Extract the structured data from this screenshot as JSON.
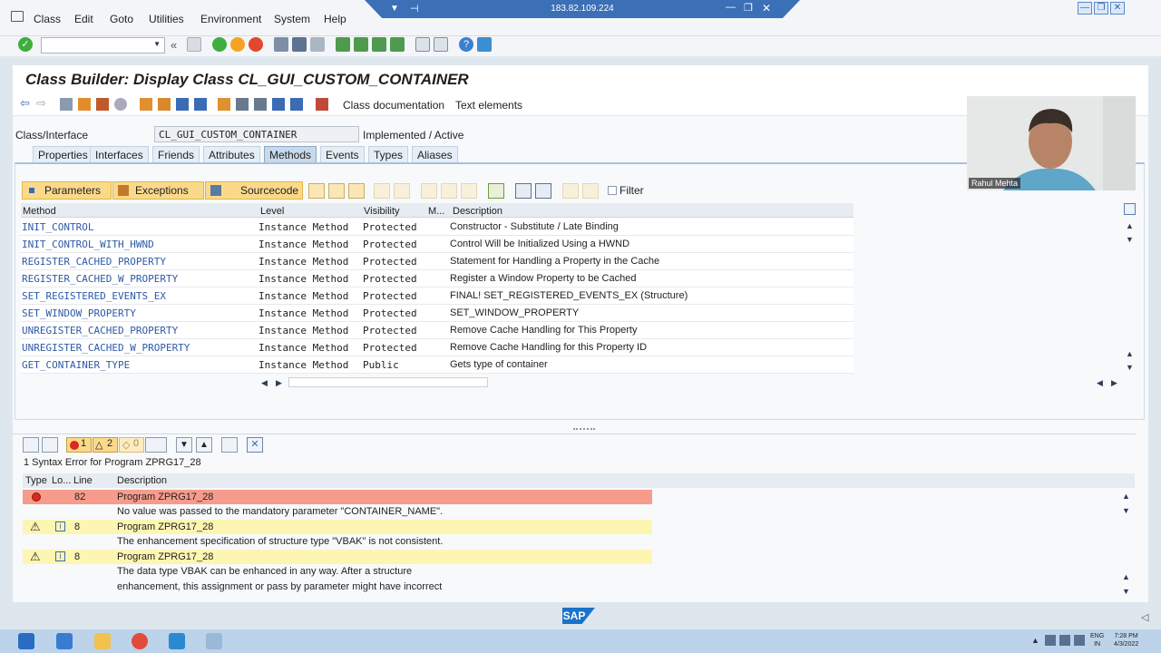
{
  "menu": {
    "items": [
      "Class",
      "Edit",
      "Goto",
      "Utilities",
      "Environment",
      "System",
      "Help"
    ]
  },
  "remote": {
    "address": "183.82.109.224"
  },
  "title": "Class Builder: Display Class CL_GUI_CUSTOM_CONTAINER",
  "app_toolbar": {
    "class_doc": "Class documentation",
    "text_elements": "Text elements"
  },
  "class_interface": {
    "label": "Class/Interface",
    "value": "CL_GUI_CUSTOM_CONTAINER",
    "status": "Implemented / Active"
  },
  "tabs": [
    "Properties",
    "Interfaces",
    "Friends",
    "Attributes",
    "Methods",
    "Events",
    "Types",
    "Aliases"
  ],
  "method_toolbar": {
    "parameters": "Parameters",
    "exceptions": "Exceptions",
    "sourcecode": "Sourcecode",
    "filter": "Filter"
  },
  "grid": {
    "headers": [
      "Method",
      "Level",
      "Visibility",
      "M...",
      "Description"
    ],
    "rows": [
      {
        "method": "INIT_CONTROL",
        "level": "Instance Method",
        "visibility": "Protected",
        "desc": "Constructor - Substitute / Late Binding"
      },
      {
        "method": "INIT_CONTROL_WITH_HWND",
        "level": "Instance Method",
        "visibility": "Protected",
        "desc": "Control Will be Initialized Using a HWND"
      },
      {
        "method": "REGISTER_CACHED_PROPERTY",
        "level": "Instance Method",
        "visibility": "Protected",
        "desc": "Statement for Handling a Property in the Cache"
      },
      {
        "method": "REGISTER_CACHED_W_PROPERTY",
        "level": "Instance Method",
        "visibility": "Protected",
        "desc": "Register a Window Property to be Cached"
      },
      {
        "method": "SET_REGISTERED_EVENTS_EX",
        "level": "Instance Method",
        "visibility": "Protected",
        "desc": "FINAL! SET_REGISTERED_EVENTS_EX (Structure)"
      },
      {
        "method": "SET_WINDOW_PROPERTY",
        "level": "Instance Method",
        "visibility": "Protected",
        "desc": "SET_WINDOW_PROPERTY"
      },
      {
        "method": "UNREGISTER_CACHED_PROPERTY",
        "level": "Instance Method",
        "visibility": "Protected",
        "desc": "Remove Cache Handling for This Property"
      },
      {
        "method": "UNREGISTER_CACHED_W_PROPERTY",
        "level": "Instance Method",
        "visibility": "Protected",
        "desc": "Remove Cache Handling for this Property ID"
      },
      {
        "method": "GET_CONTAINER_TYPE",
        "level": "Instance Method",
        "visibility": "Public",
        "desc": "Gets type of container"
      }
    ]
  },
  "errors": {
    "toolbar_counts": {
      "errors": "1",
      "warnings": "2",
      "infos": "0"
    },
    "summary": "1 Syntax Error for Program ZPRG17_28",
    "headers": [
      "Type",
      "Lo...",
      "Line",
      "Description"
    ],
    "rows": [
      {
        "line": "82",
        "program": "Program ZPRG17_28",
        "message": "No value was passed to the mandatory parameter \"CONTAINER_NAME\".",
        "message2": "",
        "kind": "error"
      },
      {
        "line": "8",
        "program": "Program ZPRG17_28",
        "message": "The enhancement specification of structure type \"VBAK\" is not consistent.",
        "message2": "",
        "kind": "warning"
      },
      {
        "line": "8",
        "program": "Program ZPRG17_28",
        "message": "The data type VBAK can be enhanced in any way. After a structure",
        "message2": "enhancement, this assignment or pass by parameter might have incorrect",
        "kind": "warning"
      }
    ]
  },
  "video": {
    "name": "Rahul Mehta"
  },
  "sap_logo": "SAP",
  "clock": {
    "time": "7:28 PM",
    "date": "4/3/2022",
    "lang": "ENG",
    "region": "IN"
  },
  "colors": {
    "error_row": "#f79b8c",
    "warning_row": "#fdf6b2",
    "accent": "#fbd98b"
  }
}
